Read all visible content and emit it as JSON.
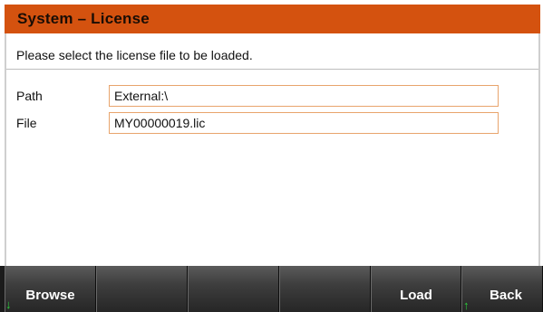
{
  "title": "System – License",
  "instruction": "Please select the license file to be loaded.",
  "fields": {
    "path": {
      "label": "Path",
      "value": "External:\\"
    },
    "file": {
      "label": "File",
      "value": "MY00000019.lic"
    }
  },
  "softkeys": {
    "browse": "Browse",
    "key2": "",
    "key3": "",
    "key4": "",
    "load": "Load",
    "back": "Back"
  },
  "indicators": {
    "down_arrow_icon": "down-arrow-icon",
    "up_arrow_icon": "up-arrow-icon"
  },
  "colors": {
    "title_bar": "#d4520f",
    "field_border": "#e8a46c",
    "arrow": "#2ad13a"
  }
}
